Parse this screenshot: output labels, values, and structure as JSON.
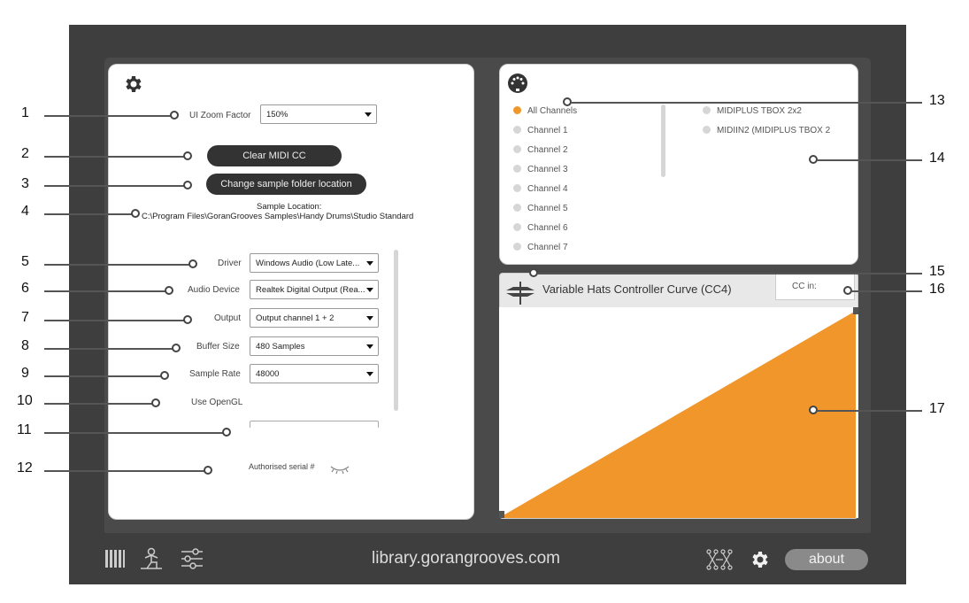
{
  "settings": {
    "zoom_label": "UI Zoom Factor",
    "zoom_value": "150%",
    "clear_midi_label": "Clear MIDI CC",
    "change_folder_label": "Change sample folder location",
    "sample_location_label": "Sample Location:",
    "sample_location_path": "C:\\Program Files\\GoranGrooves Samples\\Handy Drums\\Studio Standard",
    "driver_label": "Driver",
    "driver_value": "Windows Audio (Low Late...",
    "device_label": "Audio Device",
    "device_value": "Realtek Digital Output (Rea...",
    "output_label": "Output",
    "output_value": "Output channel 1 + 2",
    "buffer_label": "Buffer Size",
    "buffer_value": "480 Samples",
    "rate_label": "Sample Rate",
    "rate_value": "48000",
    "opengl_label": "Use OpenGL",
    "serial_label": "Authorised serial #"
  },
  "midi": {
    "channels": [
      "All Channels",
      "Channel 1",
      "Channel 2",
      "Channel 3",
      "Channel 4",
      "Channel 5",
      "Channel 6",
      "Channel 7"
    ],
    "devices": [
      "MIDIPLUS TBOX 2x2",
      "MIDIIN2 (MIDIPLUS TBOX 2"
    ]
  },
  "curve": {
    "title": "Variable Hats Controller Curve (CC4)",
    "cc_in_label": "CC in:",
    "fill_color": "#f0962a"
  },
  "footer": {
    "url": "library.gorangrooves.com",
    "about_label": "about",
    "icons": [
      "piano-icon",
      "drummer-icon",
      "sliders-icon",
      "midi-matrix-icon",
      "gear-icon"
    ]
  },
  "callouts": [
    "1",
    "2",
    "3",
    "4",
    "5",
    "6",
    "7",
    "8",
    "9",
    "10",
    "11",
    "12",
    "13",
    "14",
    "15",
    "16",
    "17"
  ]
}
